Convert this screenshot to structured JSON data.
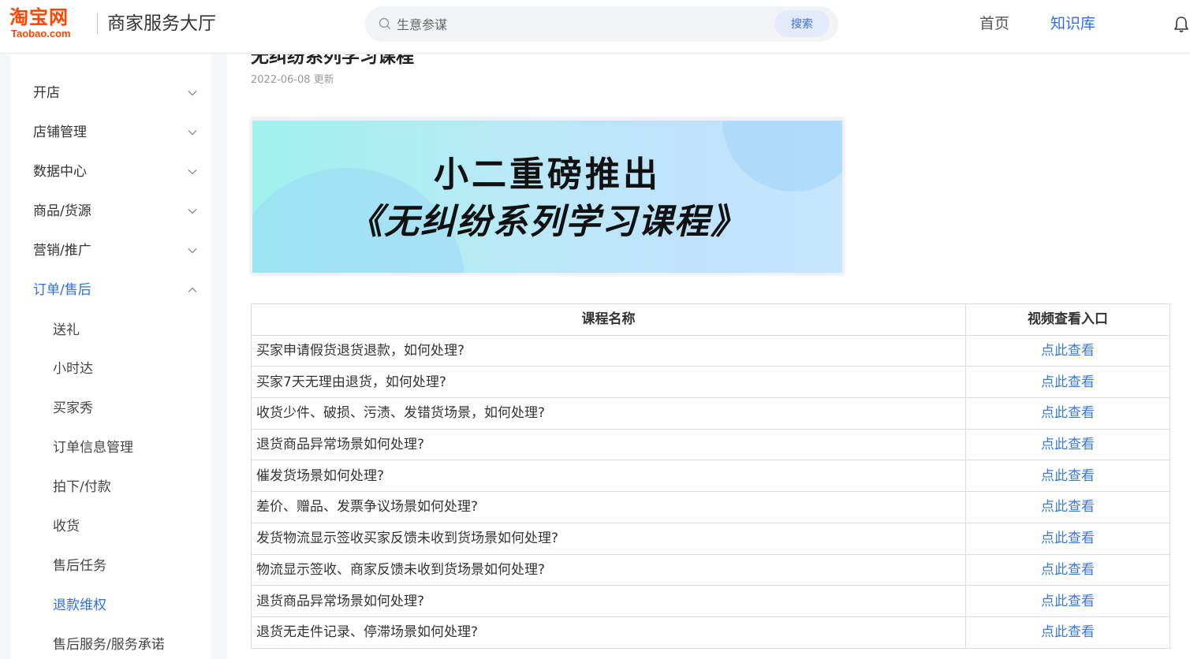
{
  "header": {
    "logo_cn": "淘宝网",
    "logo_en": "Taobao.com",
    "title": "商家服务大厅",
    "search_placeholder": "生意参谋",
    "search_button": "搜索",
    "nav": {
      "home": "首页",
      "knowledge": "知识库"
    }
  },
  "sidebar": {
    "items": [
      {
        "label": "开店"
      },
      {
        "label": "店铺管理"
      },
      {
        "label": "数据中心"
      },
      {
        "label": "商品/货源"
      },
      {
        "label": "营销/推广"
      },
      {
        "label": "订单/售后"
      }
    ],
    "sub_items": [
      {
        "label": "送礼"
      },
      {
        "label": "小时达"
      },
      {
        "label": "买家秀"
      },
      {
        "label": "订单信息管理"
      },
      {
        "label": "拍下/付款"
      },
      {
        "label": "收货"
      },
      {
        "label": "售后任务"
      },
      {
        "label": "退款维权"
      },
      {
        "label": "售后服务/服务承诺"
      }
    ]
  },
  "article": {
    "title": "无纠纷系列学习课程",
    "updated": "2022-06-08 更新",
    "banner": {
      "line1": "小二重磅推出",
      "line2": "《无纠纷系列学习课程》"
    },
    "table": {
      "headers": [
        "课程名称",
        "视频查看入口"
      ],
      "rows": [
        {
          "name": "买家申请假货退货退款，如何处理?",
          "link": "点此查看"
        },
        {
          "name": "买家7天无理由退货，如何处理?",
          "link": "点此查看"
        },
        {
          "name": "收货少件、破损、污渍、发错货场景，如何处理?",
          "link": "点此查看"
        },
        {
          "name": "退货商品异常场景如何处理?",
          "link": "点此查看"
        },
        {
          "name": "催发货场景如何处理?",
          "link": "点此查看"
        },
        {
          "name": "差价、赠品、发票争议场景如何处理?",
          "link": "点此查看"
        },
        {
          "name": "发货物流显示签收买家反馈未收到货场景如何处理?",
          "link": "点此查看"
        },
        {
          "name": "物流显示签收、商家反馈未收到货场景如何处理?",
          "link": "点此查看"
        },
        {
          "name": "退货商品异常场景如何处理?",
          "link": "点此查看"
        },
        {
          "name": "退货无走件记录、停滞场景如何处理?",
          "link": "点此查看"
        }
      ]
    }
  },
  "colors": {
    "accent": "#2f6fde",
    "link": "#3a78d8",
    "brand": "#ff4400"
  }
}
